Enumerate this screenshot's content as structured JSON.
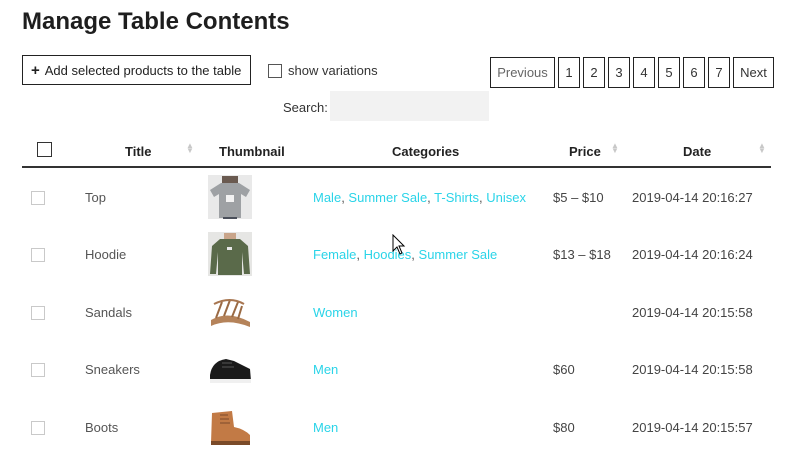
{
  "page": {
    "title": "Manage Table Contents"
  },
  "toolbar": {
    "add_label": "Add selected products to the table",
    "variations_label": "show variations",
    "search_label": "Search:",
    "search_value": ""
  },
  "pagination": {
    "previous": "Previous",
    "pages": [
      "1",
      "2",
      "3",
      "4",
      "5",
      "6",
      "7"
    ],
    "next": "Next"
  },
  "table": {
    "columns": [
      "Title",
      "Thumbnail",
      "Categories",
      "Price",
      "Date"
    ],
    "rows": [
      {
        "title": "Top",
        "thumbnail": "grey-tshirt",
        "categories": [
          "Male",
          "Summer Sale",
          "T-Shirts",
          "Unisex"
        ],
        "price": "$5 – $10",
        "date": "2019-04-14 20:16:27"
      },
      {
        "title": "Hoodie",
        "thumbnail": "green-sweatshirt",
        "categories": [
          "Female",
          "Hoodies",
          "Summer Sale"
        ],
        "price": "$13 – $18",
        "date": "2019-04-14 20:16:24"
      },
      {
        "title": "Sandals",
        "thumbnail": "tan-sandal",
        "categories": [
          "Women"
        ],
        "price": "",
        "date": "2019-04-14 20:15:58"
      },
      {
        "title": "Sneakers",
        "thumbnail": "black-sneaker",
        "categories": [
          "Men"
        ],
        "price": "$60",
        "date": "2019-04-14 20:15:58"
      },
      {
        "title": "Boots",
        "thumbnail": "brown-boot",
        "categories": [
          "Men"
        ],
        "price": "$80",
        "date": "2019-04-14 20:15:57"
      }
    ]
  },
  "colors": {
    "category_link": "#2ad4e8",
    "border": "#222222",
    "search_bg": "#f2f2f2"
  }
}
